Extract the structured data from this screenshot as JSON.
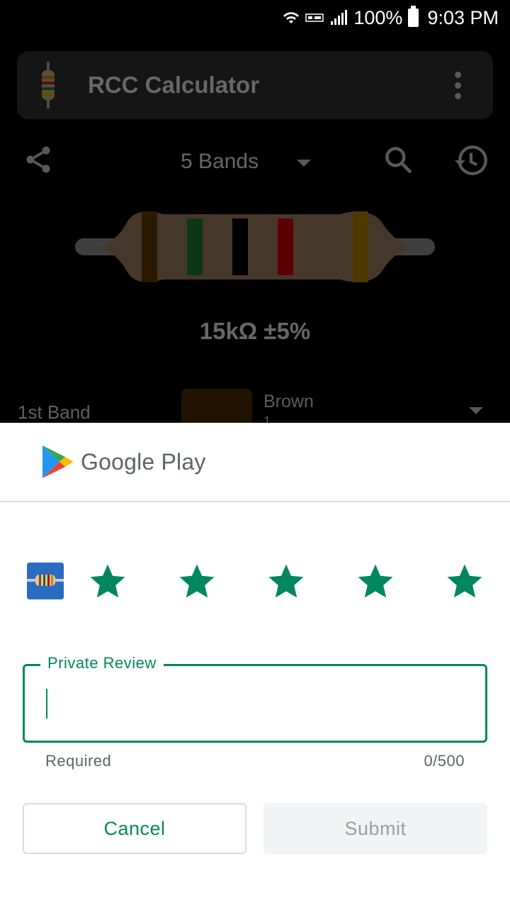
{
  "status_bar": {
    "battery": "100%",
    "time": "9:03 PM"
  },
  "app": {
    "title": "RCC Calculator",
    "bands_mode": "5 Bands",
    "value_text": "15kΩ ±5%",
    "band_row": {
      "label": "1st Band",
      "color_name": "Brown",
      "color_value": "1"
    },
    "resistor_band_colors": [
      "#3a2200",
      "#0f4a1c",
      "#000000",
      "#7a0000",
      "#6b4a00"
    ],
    "resistor_body_color": "#5e4a3a"
  },
  "google_play": {
    "brand": "Google Play",
    "rating": {
      "stars_total": 5,
      "stars_filled": 5,
      "star_color": "#01875f"
    },
    "review": {
      "label": "Private Review",
      "value": "",
      "helper": "Required",
      "counter": "0/500"
    },
    "buttons": {
      "cancel": "Cancel",
      "submit": "Submit"
    }
  }
}
